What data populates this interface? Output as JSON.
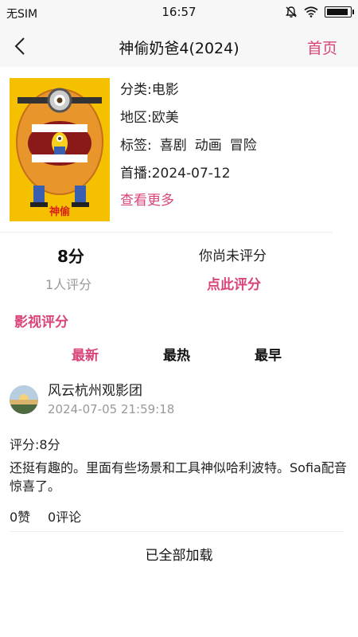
{
  "status_bar": {
    "carrier": "无SIM",
    "time": "16:57",
    "battery_level": 0.95
  },
  "nav": {
    "title": "神偷奶爸4(2024)",
    "home_label": "首页"
  },
  "movie": {
    "poster_caption": "神偷",
    "category": "分类:电影",
    "region": "地区:欧美",
    "tags_label": "标签:",
    "tags": [
      "喜剧",
      "动画",
      "冒险"
    ],
    "premiere": "首播:2024-07-12",
    "more_label": "查看更多"
  },
  "rating": {
    "score": "8分",
    "count": "1人评分",
    "user_status": "你尚未评分",
    "rate_label": "点此评分"
  },
  "reviews_section": {
    "title": "影视评分",
    "tabs": [
      "最新",
      "最热",
      "最早"
    ],
    "active_tab_index": 0
  },
  "review": {
    "user": "风云杭州观影团",
    "time": "2024-07-05 21:59:18",
    "score": "评分:8分",
    "text": "还挺有趣的。里面有些场景和工具神似哈利波特。Sofia配音惊喜了。",
    "likes": "0赞",
    "comments": "0评论"
  },
  "footer": {
    "loaded_text": "已全部加载"
  }
}
